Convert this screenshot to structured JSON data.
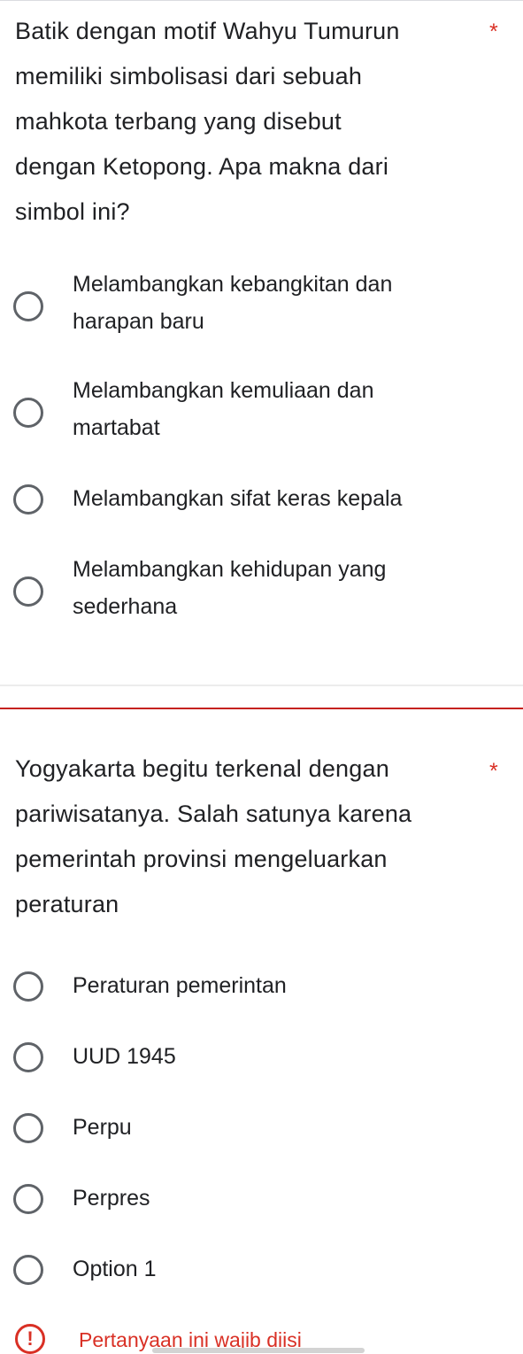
{
  "questions": [
    {
      "title": "Batik dengan motif Wahyu Tumurun memiliki simbolisasi dari sebuah mahkota terbang yang disebut dengan Ketopong. Apa makna dari simbol ini?",
      "title_lines": [
        "Batik dengan motif Wahyu Tumurun",
        "memiliki simbolisasi dari sebuah",
        "mahkota terbang yang disebut",
        "dengan Ketopong. Apa makna dari",
        "simbol ini?"
      ],
      "required_mark": "*",
      "options": [
        {
          "lines": [
            "Melambangkan kebangkitan dan",
            "harapan baru"
          ]
        },
        {
          "lines": [
            "Melambangkan kemuliaan dan",
            "martabat"
          ]
        },
        {
          "lines": [
            "Melambangkan sifat keras kepala"
          ]
        },
        {
          "lines": [
            "Melambangkan kehidupan yang",
            "sederhana"
          ]
        }
      ]
    },
    {
      "title": "Yogyakarta begitu terkenal dengan pariwisatanya. Salah satunya karena pemerintah provinsi mengeluarkan peraturan",
      "title_lines": [
        "Yogyakarta begitu terkenal dengan",
        "pariwisatanya. Salah satunya karena",
        "pemerintah provinsi mengeluarkan",
        "peraturan"
      ],
      "required_mark": "*",
      "options": [
        {
          "lines": [
            "Peraturan pemerintan"
          ]
        },
        {
          "lines": [
            "UUD 1945"
          ]
        },
        {
          "lines": [
            "Perpu"
          ]
        },
        {
          "lines": [
            "Perpres"
          ]
        },
        {
          "lines": [
            "Option 1"
          ]
        }
      ],
      "validation": {
        "icon": "!",
        "message": "Pertanyaan ini wajib diisi"
      }
    }
  ],
  "colors": {
    "text": "#202124",
    "required": "#d93025",
    "radio_border": "#5f6368",
    "divider": "#ececec",
    "error_line": "#c5221f"
  },
  "icons": {
    "radio": "radio-unchecked-icon",
    "error": "error-exclamation-icon"
  }
}
